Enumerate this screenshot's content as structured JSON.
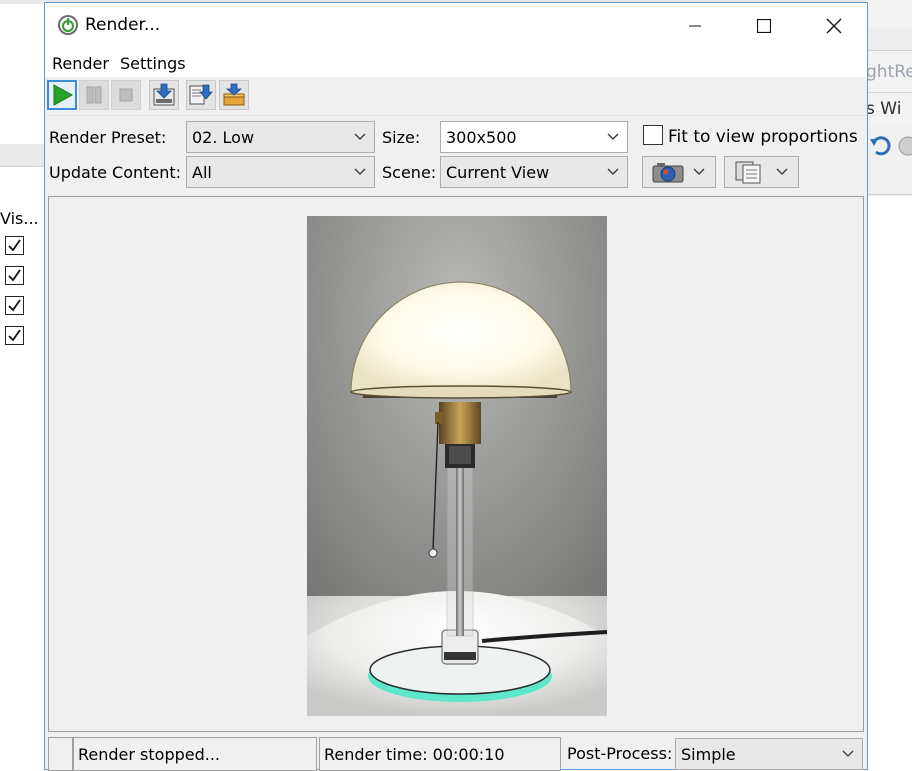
{
  "background": {
    "right_text_1": "ghtRe",
    "right_text_2": "s Wi",
    "left_column_header": "Vis..."
  },
  "dialog": {
    "title": "Render...",
    "menu": [
      "Render",
      "Settings"
    ],
    "toolbar": [
      "start-render",
      "pause-render",
      "stop-render",
      "save-render",
      "save-sequence",
      "save-to-project"
    ],
    "labels": {
      "render_preset": "Render Preset:",
      "size": "Size:",
      "update_content": "Update Content:",
      "scene": "Scene:",
      "fit_to_view": "Fit to view proportions"
    },
    "values": {
      "render_preset": "02. Low",
      "size": "300x500",
      "update_content": "All",
      "scene": "Current View"
    },
    "fit_to_view_checked": false,
    "status": {
      "state": "Render stopped...",
      "time": "Render time: 00:00:10",
      "post_process_label": "Post-Process:",
      "post_process_value": "Simple"
    },
    "accent_color": "#3c8ad8"
  }
}
